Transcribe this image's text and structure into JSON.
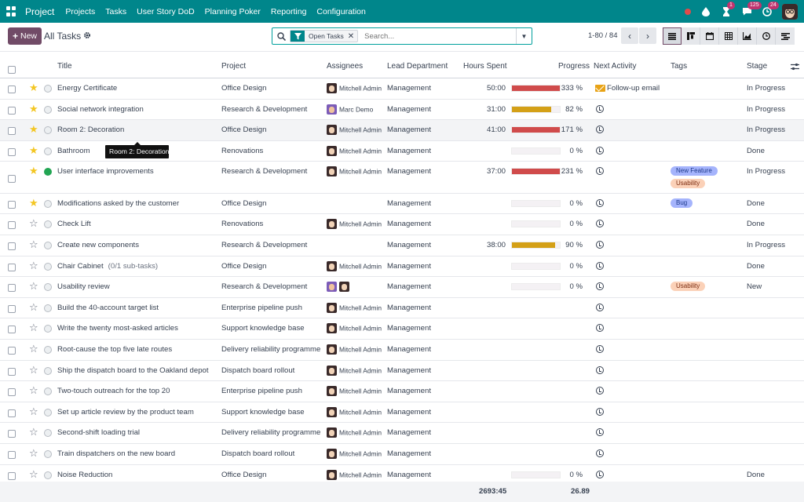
{
  "navbar": {
    "brand": "Project",
    "menu": [
      "Projects",
      "Tasks",
      "User Story DoD",
      "Planning Poker",
      "Reporting",
      "Configuration"
    ],
    "badges": {
      "activities": "1",
      "messages": "125",
      "clock": "24"
    }
  },
  "control": {
    "new_label": "New",
    "title": "All Tasks",
    "facet": "Open Tasks",
    "search_placeholder": "Search...",
    "pager": "1-80 / 84"
  },
  "columns": {
    "title": "Title",
    "project": "Project",
    "assignees": "Assignees",
    "lead_department": "Lead Department",
    "hours_spent": "Hours Spent",
    "progress": "Progress",
    "next_activity": "Next Activity",
    "tags": "Tags",
    "stage": "Stage"
  },
  "rows": [
    {
      "title": "Energy Certificate",
      "sub": "",
      "project": "Office Design",
      "assignees": [
        "mitchell"
      ],
      "assignee_label": "Mitchell Admin",
      "dept": "Management",
      "hours": "50:00",
      "progress": 333,
      "progress_text": "333 %",
      "activity": "mail",
      "activity_label": "Follow-up email",
      "tags": [],
      "stage": "In Progress",
      "star": true,
      "kanban": "normal"
    },
    {
      "title": "Social network integration",
      "sub": "",
      "project": "Research & Development",
      "assignees": [
        "marc"
      ],
      "assignee_label": "Marc Demo",
      "dept": "Management",
      "hours": "31:00",
      "progress": 82,
      "progress_text": "82 %",
      "activity": "clock",
      "activity_label": "",
      "tags": [],
      "stage": "In Progress",
      "star": true,
      "kanban": "normal"
    },
    {
      "title": "Room 2: Decoration",
      "sub": "",
      "project": "Office Design",
      "assignees": [
        "mitchell"
      ],
      "assignee_label": "Mitchell Admin",
      "dept": "Management",
      "hours": "41:00",
      "progress": 171,
      "progress_text": "171 %",
      "activity": "clock",
      "activity_label": "",
      "tags": [],
      "stage": "In Progress",
      "star": true,
      "kanban": "normal"
    },
    {
      "title": "Bathroom",
      "sub": "",
      "project": "Renovations",
      "assignees": [
        "mitchell"
      ],
      "assignee_label": "Mitchell Admin",
      "dept": "Management",
      "hours": "",
      "progress": 0,
      "progress_text": "0 %",
      "activity": "clock",
      "activity_label": "",
      "tags": [],
      "stage": "Done",
      "star": true,
      "kanban": "normal"
    },
    {
      "title": "User interface improvements",
      "sub": "",
      "project": "Research & Development",
      "assignees": [
        "mitchell"
      ],
      "assignee_label": "Mitchell Admin",
      "dept": "Management",
      "hours": "37:00",
      "progress": 231,
      "progress_text": "231 %",
      "activity": "clock",
      "activity_label": "",
      "tags": [
        "New Feature",
        "Usability"
      ],
      "stage": "In Progress",
      "star": true,
      "kanban": "green"
    },
    {
      "title": "Modifications asked by the customer",
      "sub": "",
      "project": "Office Design",
      "assignees": [],
      "assignee_label": "",
      "dept": "Management",
      "hours": "",
      "progress": 0,
      "progress_text": "0 %",
      "activity": "clock",
      "activity_label": "",
      "tags": [
        "Bug"
      ],
      "stage": "Done",
      "star": true,
      "kanban": "normal"
    },
    {
      "title": "Check Lift",
      "sub": "",
      "project": "Renovations",
      "assignees": [
        "mitchell"
      ],
      "assignee_label": "Mitchell Admin",
      "dept": "Management",
      "hours": "",
      "progress": 0,
      "progress_text": "0 %",
      "activity": "clock",
      "activity_label": "",
      "tags": [],
      "stage": "Done",
      "star": false,
      "kanban": "normal"
    },
    {
      "title": "Create new components",
      "sub": "",
      "project": "Research & Development",
      "assignees": [],
      "assignee_label": "",
      "dept": "Management",
      "hours": "38:00",
      "progress": 90,
      "progress_text": "90 %",
      "activity": "clock",
      "activity_label": "",
      "tags": [],
      "stage": "In Progress",
      "star": false,
      "kanban": "normal"
    },
    {
      "title": "Chair Cabinet",
      "sub": "(0/1 sub-tasks)",
      "project": "Office Design",
      "assignees": [
        "mitchell"
      ],
      "assignee_label": "Mitchell Admin",
      "dept": "Management",
      "hours": "",
      "progress": 0,
      "progress_text": "0 %",
      "activity": "clock",
      "activity_label": "",
      "tags": [],
      "stage": "Done",
      "star": false,
      "kanban": "normal"
    },
    {
      "title": "Usability review",
      "sub": "",
      "project": "Research & Development",
      "assignees": [
        "marc",
        "mitchell"
      ],
      "assignee_label": "",
      "dept": "Management",
      "hours": "",
      "progress": 0,
      "progress_text": "0 %",
      "activity": "clock",
      "activity_label": "",
      "tags": [
        "Usability"
      ],
      "stage": "New",
      "star": false,
      "kanban": "normal"
    },
    {
      "title": "Build the 40-account target list",
      "sub": "",
      "project": "Enterprise pipeline push",
      "assignees": [
        "mitchell"
      ],
      "assignee_label": "Mitchell Admin",
      "dept": "Management",
      "hours": "",
      "progress": null,
      "progress_text": "",
      "activity": "clock",
      "activity_label": "",
      "tags": [],
      "stage": "",
      "star": false,
      "kanban": "normal"
    },
    {
      "title": "Write the twenty most-asked articles",
      "sub": "",
      "project": "Support knowledge base",
      "assignees": [
        "mitchell"
      ],
      "assignee_label": "Mitchell Admin",
      "dept": "Management",
      "hours": "",
      "progress": null,
      "progress_text": "",
      "activity": "clock",
      "activity_label": "",
      "tags": [],
      "stage": "",
      "star": false,
      "kanban": "normal"
    },
    {
      "title": "Root-cause the top five late routes",
      "sub": "",
      "project": "Delivery reliability programme",
      "assignees": [
        "mitchell"
      ],
      "assignee_label": "Mitchell Admin",
      "dept": "Management",
      "hours": "",
      "progress": null,
      "progress_text": "",
      "activity": "clock",
      "activity_label": "",
      "tags": [],
      "stage": "",
      "star": false,
      "kanban": "normal"
    },
    {
      "title": "Ship the dispatch board to the Oakland depot",
      "sub": "",
      "project": "Dispatch board rollout",
      "assignees": [
        "mitchell"
      ],
      "assignee_label": "Mitchell Admin",
      "dept": "Management",
      "hours": "",
      "progress": null,
      "progress_text": "",
      "activity": "clock",
      "activity_label": "",
      "tags": [],
      "stage": "",
      "star": false,
      "kanban": "normal"
    },
    {
      "title": "Two-touch outreach for the top 20",
      "sub": "",
      "project": "Enterprise pipeline push",
      "assignees": [
        "mitchell"
      ],
      "assignee_label": "Mitchell Admin",
      "dept": "Management",
      "hours": "",
      "progress": null,
      "progress_text": "",
      "activity": "clock",
      "activity_label": "",
      "tags": [],
      "stage": "",
      "star": false,
      "kanban": "normal"
    },
    {
      "title": "Set up article review by the product team",
      "sub": "",
      "project": "Support knowledge base",
      "assignees": [
        "mitchell"
      ],
      "assignee_label": "Mitchell Admin",
      "dept": "Management",
      "hours": "",
      "progress": null,
      "progress_text": "",
      "activity": "clock",
      "activity_label": "",
      "tags": [],
      "stage": "",
      "star": false,
      "kanban": "normal"
    },
    {
      "title": "Second-shift loading trial",
      "sub": "",
      "project": "Delivery reliability programme",
      "assignees": [
        "mitchell"
      ],
      "assignee_label": "Mitchell Admin",
      "dept": "Management",
      "hours": "",
      "progress": null,
      "progress_text": "",
      "activity": "clock",
      "activity_label": "",
      "tags": [],
      "stage": "",
      "star": false,
      "kanban": "normal"
    },
    {
      "title": "Train dispatchers on the new board",
      "sub": "",
      "project": "Dispatch board rollout",
      "assignees": [
        "mitchell"
      ],
      "assignee_label": "Mitchell Admin",
      "dept": "Management",
      "hours": "",
      "progress": null,
      "progress_text": "",
      "activity": "clock",
      "activity_label": "",
      "tags": [],
      "stage": "",
      "star": false,
      "kanban": "normal"
    },
    {
      "title": "Noise Reduction",
      "sub": "",
      "project": "Office Design",
      "assignees": [
        "mitchell"
      ],
      "assignee_label": "Mitchell Admin",
      "dept": "Management",
      "hours": "",
      "progress": 0,
      "progress_text": "0 %",
      "activity": "clock",
      "activity_label": "",
      "tags": [],
      "stage": "Done",
      "star": false,
      "kanban": "normal"
    }
  ],
  "tooltip": "Room 2: Decoration",
  "totals": {
    "hours": "2693:45",
    "progress": "26.89"
  },
  "colors": {
    "navbar": "#00868b",
    "primary": "#714b67",
    "bar_over": "#d04b4b",
    "bar_ok": "#d4a017"
  }
}
